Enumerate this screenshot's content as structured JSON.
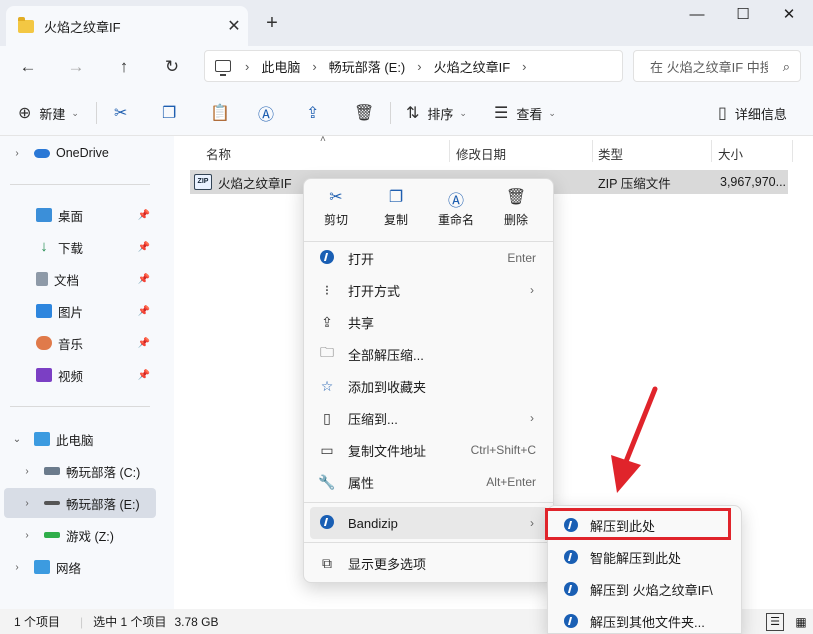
{
  "window": {
    "tab_title": "火焰之纹章IF",
    "close_tab": "✕",
    "new_tab": "+",
    "minimize": "—",
    "maximize": "☐",
    "close": "✕"
  },
  "address": {
    "crumbs": [
      "此电脑",
      "畅玩部落 (E:)",
      "火焰之纹章IF"
    ],
    "search_placeholder": "在 火焰之纹章IF 中搜索"
  },
  "toolbar": {
    "new_label": "新建",
    "sort_label": "排序",
    "view_label": "查看",
    "details_label": "详细信息"
  },
  "sidebar": {
    "items": [
      {
        "label": "OneDrive"
      },
      {
        "label": "桌面"
      },
      {
        "label": "下载"
      },
      {
        "label": "文档"
      },
      {
        "label": "图片"
      },
      {
        "label": "音乐"
      },
      {
        "label": "视频"
      },
      {
        "label": "此电脑"
      },
      {
        "label": "畅玩部落 (C:)"
      },
      {
        "label": "畅玩部落 (E:)"
      },
      {
        "label": "游戏 (Z:)"
      },
      {
        "label": "网络"
      }
    ]
  },
  "columns": {
    "name": "名称",
    "modified": "修改日期",
    "type": "类型",
    "size": "大小"
  },
  "file": {
    "name": "火焰之纹章IF",
    "type": "ZIP 压缩文件",
    "size": "3,967,970..."
  },
  "status": {
    "count": "1 个项目",
    "selected": "选中 1 个项目",
    "size": "3.78 GB"
  },
  "context_menu": {
    "top": [
      {
        "label": "剪切"
      },
      {
        "label": "复制"
      },
      {
        "label": "重命名"
      },
      {
        "label": "删除"
      }
    ],
    "items": [
      {
        "label": "打开",
        "accel": "Enter"
      },
      {
        "label": "打开方式"
      },
      {
        "label": "共享"
      },
      {
        "label": "全部解压缩..."
      },
      {
        "label": "添加到收藏夹"
      },
      {
        "label": "压缩到..."
      },
      {
        "label": "复制文件地址",
        "accel": "Ctrl+Shift+C"
      },
      {
        "label": "属性",
        "accel": "Alt+Enter"
      },
      {
        "label": "Bandizip"
      },
      {
        "label": "显示更多选项"
      }
    ]
  },
  "submenu": {
    "items": [
      {
        "label": "解压到此处"
      },
      {
        "label": "智能解压到此处"
      },
      {
        "label": "解压到 火焰之纹章IF\\"
      },
      {
        "label": "解压到其他文件夹..."
      }
    ]
  },
  "colors": {
    "accent": "#1a5fb4",
    "highlight_box": "#e0242b"
  }
}
